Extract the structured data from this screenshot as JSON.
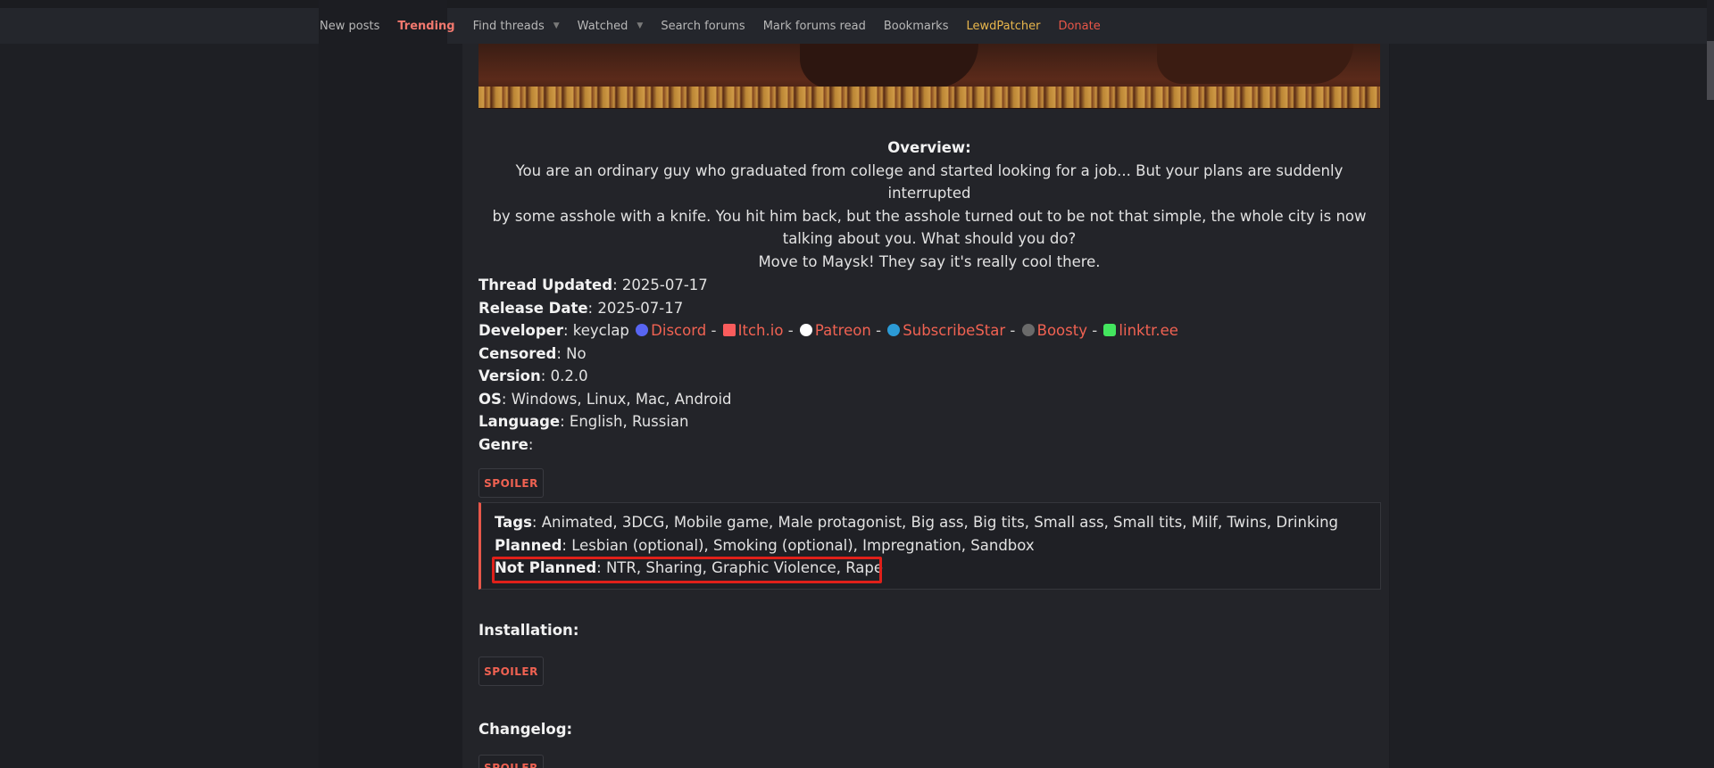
{
  "nav": {
    "items": [
      {
        "label": "New posts",
        "dropdown": false,
        "style": "normal"
      },
      {
        "label": "Trending",
        "dropdown": false,
        "style": "trending"
      },
      {
        "label": "Find threads",
        "dropdown": true,
        "style": "normal"
      },
      {
        "label": "Watched",
        "dropdown": true,
        "style": "normal"
      },
      {
        "label": "Search forums",
        "dropdown": false,
        "style": "normal"
      },
      {
        "label": "Mark forums read",
        "dropdown": false,
        "style": "normal"
      },
      {
        "label": "Bookmarks",
        "dropdown": false,
        "style": "normal"
      },
      {
        "label": "LewdPatcher",
        "dropdown": false,
        "style": "lewd"
      },
      {
        "label": "Donate",
        "dropdown": false,
        "style": "donate"
      }
    ]
  },
  "overview": {
    "heading": "Overview:",
    "lines": [
      "You are an ordinary guy who graduated from college and started looking for a job... But your plans are suddenly interrupted",
      "by some asshole with a knife. You hit him back, but the asshole turned out to be not that simple, the whole city is now",
      "talking about you. What should you do?",
      "Move to Maysk! They say it's really cool there."
    ]
  },
  "fields": {
    "thread_updated": {
      "label": "Thread Updated",
      "value": "2025-07-17"
    },
    "release_date": {
      "label": "Release Date",
      "value": "2025-07-17"
    },
    "developer": {
      "label": "Developer",
      "name": "keyclap",
      "links": [
        {
          "label": "Discord",
          "icon": "discord-icon"
        },
        {
          "label": "Itch.io",
          "icon": "itchio-icon"
        },
        {
          "label": "Patreon",
          "icon": "patreon-icon"
        },
        {
          "label": "SubscribeStar",
          "icon": "subscribestar-icon"
        },
        {
          "label": "Boosty",
          "icon": "boosty-icon"
        },
        {
          "label": "linktr.ee",
          "icon": "linktree-icon"
        }
      ]
    },
    "censored": {
      "label": "Censored",
      "value": "No"
    },
    "version": {
      "label": "Version",
      "value": "0.2.0"
    },
    "os": {
      "label": "OS",
      "value": "Windows, Linux, Mac, Android"
    },
    "language": {
      "label": "Language",
      "value": "English, Russian"
    },
    "genre": {
      "label": "Genre",
      "value": ""
    }
  },
  "spoiler_label": "SPOILER",
  "genre_spoiler": {
    "tags": {
      "label": "Tags",
      "value": "Animated, 3DCG, Mobile game, Male protagonist, Big ass, Big tits, Small ass, Small tits, Milf, Twins, Drinking"
    },
    "planned": {
      "label": "Planned",
      "value": "Lesbian (optional), Smoking (optional), Impregnation, Sandbox"
    },
    "not_planned": {
      "label": "Not Planned",
      "value": "NTR, Sharing, Graphic Violence, Rape"
    }
  },
  "sections": {
    "installation": "Installation",
    "changelog": "Changelog"
  },
  "colors": {
    "accent": "#f06252",
    "highlight_box": "#e0201a",
    "trending": "#f2786e",
    "lewdpatcher": "#e8b64c"
  }
}
